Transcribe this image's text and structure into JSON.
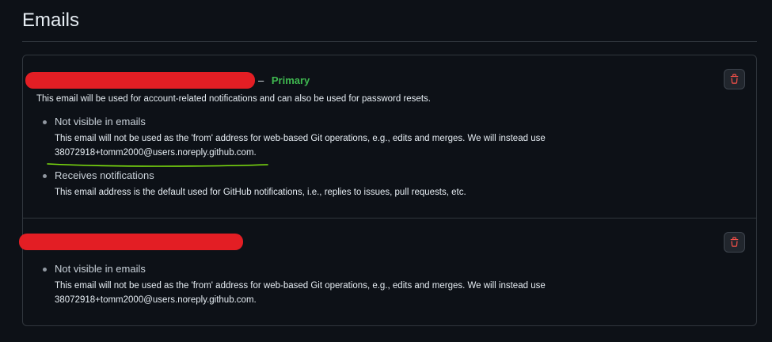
{
  "page": {
    "title": "Emails"
  },
  "emails": [
    {
      "primary_separator": "–",
      "primary_label": "Primary",
      "note": "This email will be used for account-related notifications and can also be used for password resets.",
      "properties": [
        {
          "title": "Not visible in emails",
          "description": "This email will not be used as the 'from' address for web-based Git operations, e.g., edits and merges. We will instead use 38072918+tomm2000@users.noreply.github.com."
        },
        {
          "title": "Receives notifications",
          "description": "This email address is the default used for GitHub notifications, i.e., replies to issues, pull requests, etc."
        }
      ]
    },
    {
      "properties": [
        {
          "title": "Not visible in emails",
          "description": "This email will not be used as the 'from' address for web-based Git operations, e.g., edits and merges. We will instead use 38072918+tomm2000@users.noreply.github.com."
        }
      ]
    }
  ],
  "colors": {
    "background": "#0d1117",
    "border": "#30363d",
    "primary_badge": "#3fb950",
    "delete_icon": "#f85149",
    "redaction": "#e31e24",
    "annotation_underline": "#7ee00f"
  },
  "icons": {
    "delete": "trash-icon"
  }
}
